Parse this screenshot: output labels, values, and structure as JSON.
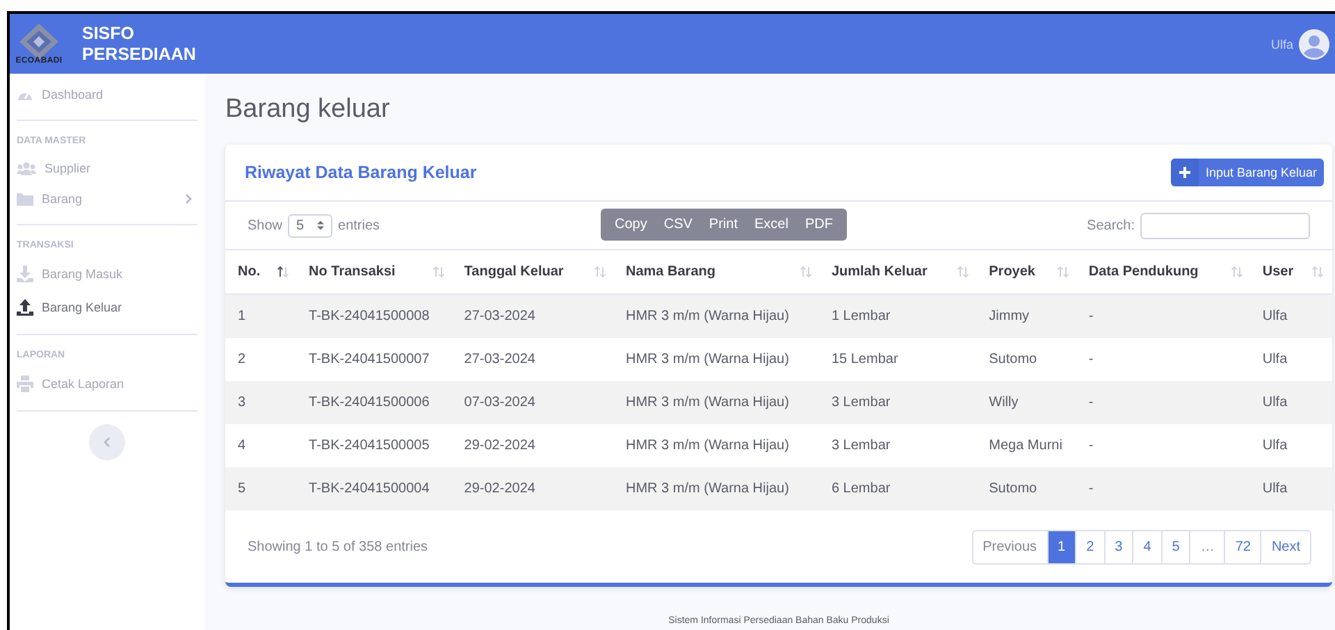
{
  "header": {
    "logo_text": "ECOABADI",
    "app_name": "SISFO PERSEDIAAN",
    "user": "Ulfa"
  },
  "sidebar": {
    "sections": [
      {
        "items": [
          {
            "label": "Dashboard",
            "kind": "link",
            "selected": false
          }
        ]
      },
      {
        "heading": "DATA MASTER",
        "items": [
          {
            "label": "Supplier",
            "kind": "link",
            "selected": false
          },
          {
            "label": "Barang",
            "kind": "submenu",
            "selected": false
          }
        ]
      },
      {
        "heading": "TRANSAKSI",
        "items": [
          {
            "label": "Barang Masuk",
            "kind": "link",
            "selected": false
          },
          {
            "label": "Barang Keluar",
            "kind": "link",
            "selected": true
          }
        ]
      },
      {
        "heading": "LAPORAN",
        "items": [
          {
            "label": "Cetak Laporan",
            "kind": "link",
            "selected": false
          }
        ]
      }
    ]
  },
  "page_title": "Barang keluar",
  "card": {
    "title": "Riwayat Data Barang Keluar",
    "add_button": "Input Barang Keluar",
    "length": {
      "before": "Show",
      "value": "5",
      "after": "entries"
    },
    "export_buttons": [
      "Copy",
      "CSV",
      "Print",
      "Excel",
      "PDF"
    ],
    "search_label": "Search:",
    "columns": [
      {
        "label": "No.",
        "sorted": true
      },
      {
        "label": "No Transaksi",
        "sorted": false
      },
      {
        "label": "Tanggal Keluar",
        "sorted": false
      },
      {
        "label": "Nama Barang",
        "sorted": false
      },
      {
        "label": "Jumlah Keluar",
        "sorted": false
      },
      {
        "label": "Proyek",
        "sorted": false
      },
      {
        "label": "Data Pendukung",
        "sorted": false
      },
      {
        "label": "User",
        "sorted": false
      }
    ],
    "rows": [
      [
        "1",
        "T-BK-24041500008",
        "27-03-2024",
        "HMR 3 m/m (Warna Hijau)",
        "1 Lembar",
        "Jimmy",
        "-",
        "Ulfa"
      ],
      [
        "2",
        "T-BK-24041500007",
        "27-03-2024",
        "HMR 3 m/m (Warna Hijau)",
        "15 Lembar",
        "Sutomo",
        "-",
        "Ulfa"
      ],
      [
        "3",
        "T-BK-24041500006",
        "07-03-2024",
        "HMR 3 m/m (Warna Hijau)",
        "3 Lembar",
        "Willy",
        "-",
        "Ulfa"
      ],
      [
        "4",
        "T-BK-24041500005",
        "29-02-2024",
        "HMR 3 m/m (Warna Hijau)",
        "3 Lembar",
        "Mega Murni",
        "-",
        "Ulfa"
      ],
      [
        "5",
        "T-BK-24041500004",
        "29-02-2024",
        "HMR 3 m/m (Warna Hijau)",
        "6 Lembar",
        "Sutomo",
        "-",
        "Ulfa"
      ]
    ],
    "info": "Showing 1 to 5 of 358 entries",
    "pagination": [
      {
        "label": "Previous",
        "kind": "nav",
        "selected": false
      },
      {
        "label": "1",
        "kind": "page",
        "selected": true
      },
      {
        "label": "2",
        "kind": "page",
        "selected": false
      },
      {
        "label": "3",
        "kind": "page",
        "selected": false
      },
      {
        "label": "4",
        "kind": "page",
        "selected": false
      },
      {
        "label": "5",
        "kind": "page",
        "selected": false
      },
      {
        "label": "…",
        "kind": "ellipsis",
        "selected": false
      },
      {
        "label": "72",
        "kind": "page",
        "selected": false
      },
      {
        "label": "Next",
        "kind": "nav",
        "selected": false
      }
    ]
  },
  "footer": "Sistem Informasi Persediaan Bahan Baku Produksi"
}
